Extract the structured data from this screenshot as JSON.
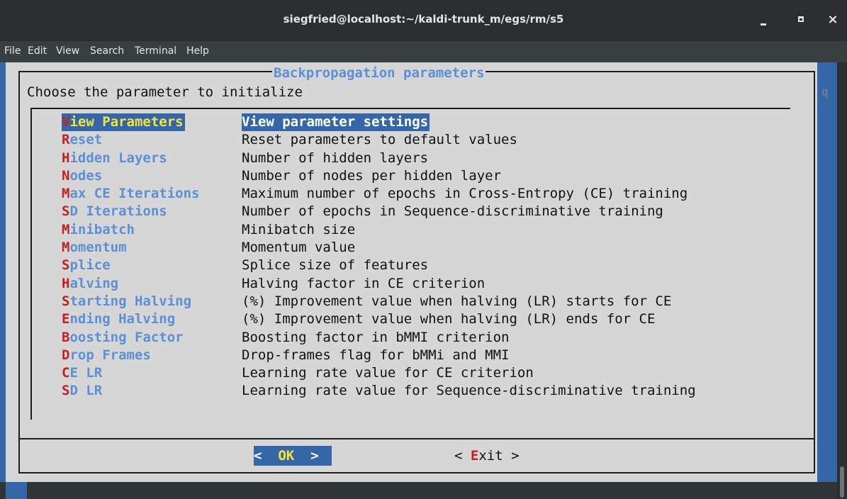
{
  "window": {
    "title": "siegfried@localhost:~/kaldi-trunk_m/egs/rm/s5",
    "minimize_icon": "minimize-icon",
    "maximize_icon": "maximize-icon",
    "close_symbol": "×"
  },
  "menu": {
    "file": "File",
    "edit": "Edit",
    "view": "View",
    "search": "Search",
    "terminal": "Terminal",
    "help": "Help"
  },
  "dialog": {
    "title": "Backpropagation parameters",
    "prompt": "Choose the parameter to initialize",
    "items": [
      {
        "hotkey": "V",
        "rest": "iew Parameters",
        "desc": "View parameter settings",
        "selected": true
      },
      {
        "hotkey": "R",
        "rest": "eset",
        "desc": "Reset parameters to default values"
      },
      {
        "hotkey": "H",
        "rest": "idden Layers",
        "desc": "Number of hidden layers"
      },
      {
        "hotkey": "N",
        "rest": "odes",
        "desc": "Number of nodes per hidden layer"
      },
      {
        "hotkey": "M",
        "rest": "ax CE Iterations",
        "desc": "Maximum number of epochs in Cross-Entropy (CE) training"
      },
      {
        "hotkey": "S",
        "rest": "D Iterations",
        "desc": "Number of epochs in Sequence-discriminative training"
      },
      {
        "hotkey": "M",
        "rest": "inibatch",
        "desc": "Minibatch size"
      },
      {
        "hotkey": "M",
        "rest": "omentum",
        "desc": "Momentum value"
      },
      {
        "hotkey": "S",
        "rest": "plice",
        "desc": "Splice size of features"
      },
      {
        "hotkey": "H",
        "rest": "alving",
        "desc": "Halving factor in CE criterion"
      },
      {
        "hotkey": "S",
        "rest": "tarting Halving",
        "desc": "(%) Improvement value when halving (LR) starts for CE"
      },
      {
        "hotkey": "E",
        "rest": "nding Halving",
        "desc": "(%) Improvement value when halving (LR) ends for CE"
      },
      {
        "hotkey": "B",
        "rest": "oosting Factor",
        "desc": "Boosting factor in bMMI criterion"
      },
      {
        "hotkey": "D",
        "rest": "rop Frames",
        "desc": "Drop-frames flag for bMMi and MMI"
      },
      {
        "hotkey": "C",
        "rest": "E LR",
        "desc": "Learning rate value for CE criterion"
      },
      {
        "hotkey": "S",
        "rest": "D LR",
        "desc": "Learning rate value for Sequence-discriminative training"
      }
    ],
    "ok_button": {
      "left": "<  ",
      "hotkey": "O",
      "rest": "K",
      "right": "  >"
    },
    "exit_button": {
      "left": "< ",
      "hotkey": "E",
      "rest": "xit",
      "right": " >"
    }
  },
  "terminal": {
    "edge_char": "q"
  },
  "colors": {
    "dialog_bg": "#d6d6d6",
    "accent_blue": "#3566a8",
    "item_blue": "#5b8fd6",
    "hotkey_red": "#c42020",
    "highlight_yellow": "#f2e53d"
  }
}
